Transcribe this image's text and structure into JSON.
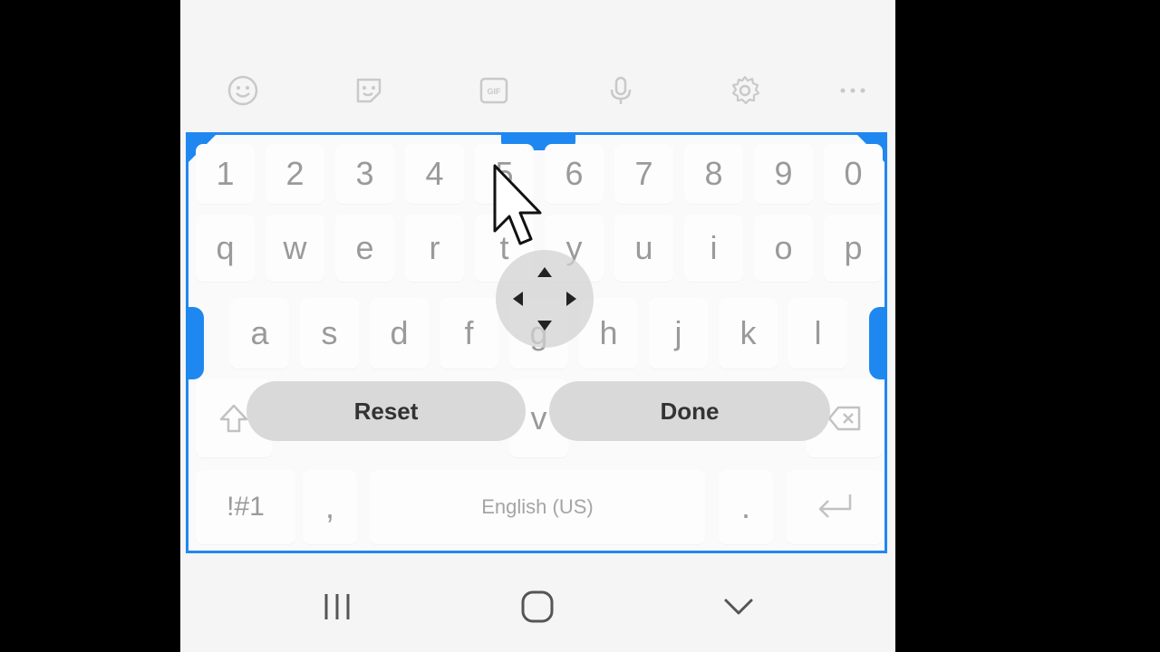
{
  "toolbar": {
    "icons": [
      "emoji-icon",
      "sticker-icon",
      "gif-icon",
      "microphone-icon",
      "settings-gear-icon",
      "more-options-icon"
    ],
    "gif_label": "GIF"
  },
  "keyboard": {
    "number_row": [
      "1",
      "2",
      "3",
      "4",
      "5",
      "6",
      "7",
      "8",
      "9",
      "0"
    ],
    "row_q": [
      "q",
      "w",
      "e",
      "r",
      "t",
      "y",
      "u",
      "i",
      "o",
      "p"
    ],
    "row_a": [
      "a",
      "s",
      "d",
      "f",
      "g",
      "h",
      "j",
      "k",
      "l"
    ],
    "row_z_partial": [
      "v"
    ],
    "bottom": {
      "symbols_label": "!#1",
      "comma_label": ",",
      "space_label": "English (US)",
      "period_label": "."
    }
  },
  "resize_mode": {
    "reset_label": "Reset",
    "done_label": "Done",
    "frame_color": "#1e88f0"
  },
  "navigation": {
    "buttons": [
      "recent-apps-icon",
      "home-icon",
      "back-icon"
    ]
  }
}
